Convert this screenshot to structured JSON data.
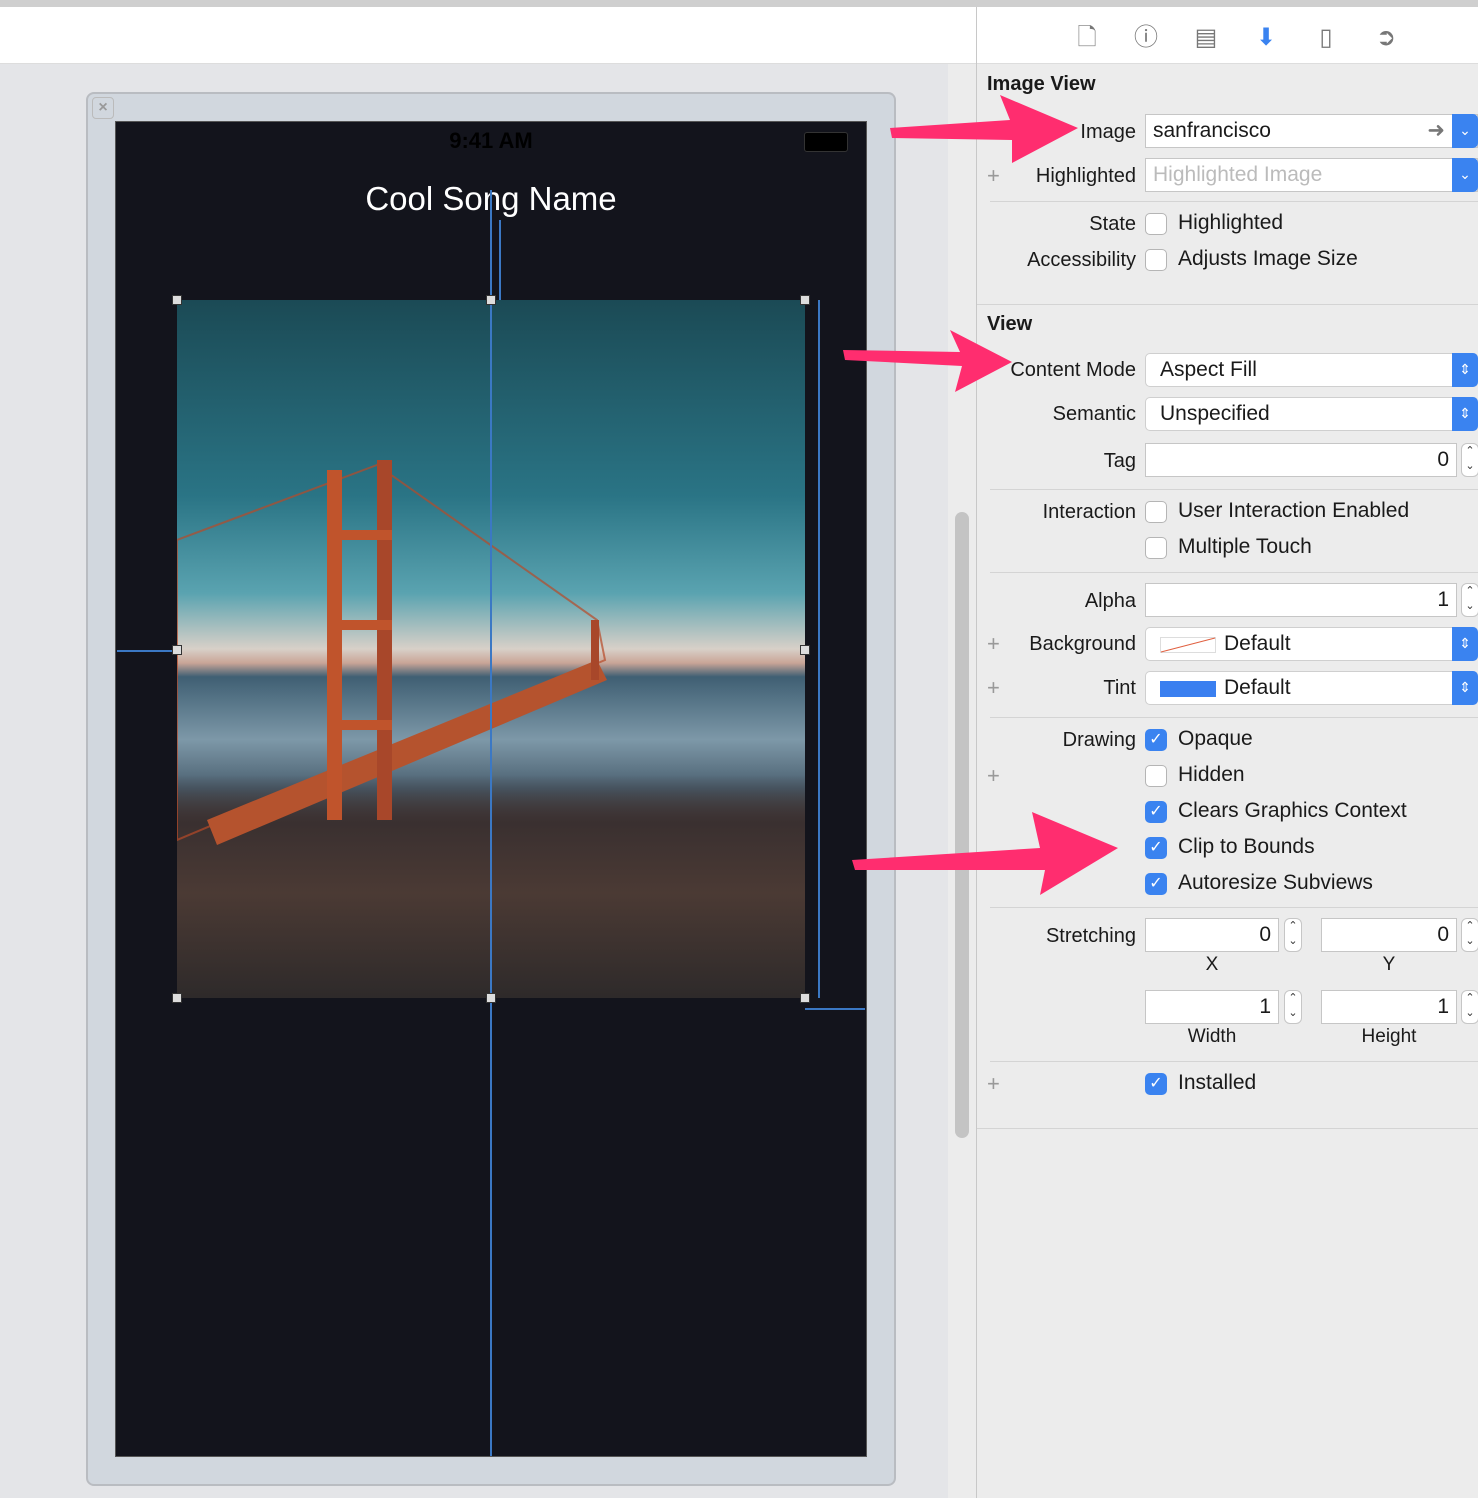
{
  "toolbar": {
    "icons": [
      "file-inspector-icon",
      "quick-help-icon",
      "identity-inspector-icon",
      "attributes-inspector-icon",
      "size-inspector-icon",
      "connections-inspector-icon"
    ],
    "selected": "attributes-inspector-icon",
    "accent": "#3a83f0"
  },
  "canvas": {
    "status_time": "9:41 AM",
    "song_title": "Cool Song Name",
    "image_name": "sanfrancisco"
  },
  "annotation_color": "#ff2d6f",
  "image_view": {
    "section": "Image View",
    "image_label": "Image",
    "image_value": "sanfrancisco",
    "highlighted_label": "Highlighted",
    "highlighted_placeholder": "Highlighted Image",
    "state_label": "State",
    "state_option": "Highlighted",
    "state_checked": false,
    "accessibility_label": "Accessibility",
    "accessibility_option": "Adjusts Image Size",
    "accessibility_checked": false
  },
  "view": {
    "section": "View",
    "content_mode_label": "Content Mode",
    "content_mode": "Aspect Fill",
    "semantic_label": "Semantic",
    "semantic": "Unspecified",
    "tag_label": "Tag",
    "tag": "0",
    "interaction_label": "Interaction",
    "user_interaction": "User Interaction Enabled",
    "multiple_touch": "Multiple Touch",
    "alpha_label": "Alpha",
    "alpha": "1",
    "background_label": "Background",
    "background": "Default",
    "tint_label": "Tint",
    "tint": "Default",
    "tint_color": "#3a7ff0",
    "drawing_label": "Drawing",
    "opaque": "Opaque",
    "hidden": "Hidden",
    "clears": "Clears Graphics Context",
    "clip": "Clip to Bounds",
    "autoresize": "Autoresize Subviews",
    "stretching_label": "Stretching",
    "stretch_x": "0",
    "stretch_y": "0",
    "x_label": "X",
    "y_label": "Y",
    "stretch_w": "1",
    "stretch_h": "1",
    "width_label": "Width",
    "height_label": "Height",
    "installed": "Installed"
  }
}
